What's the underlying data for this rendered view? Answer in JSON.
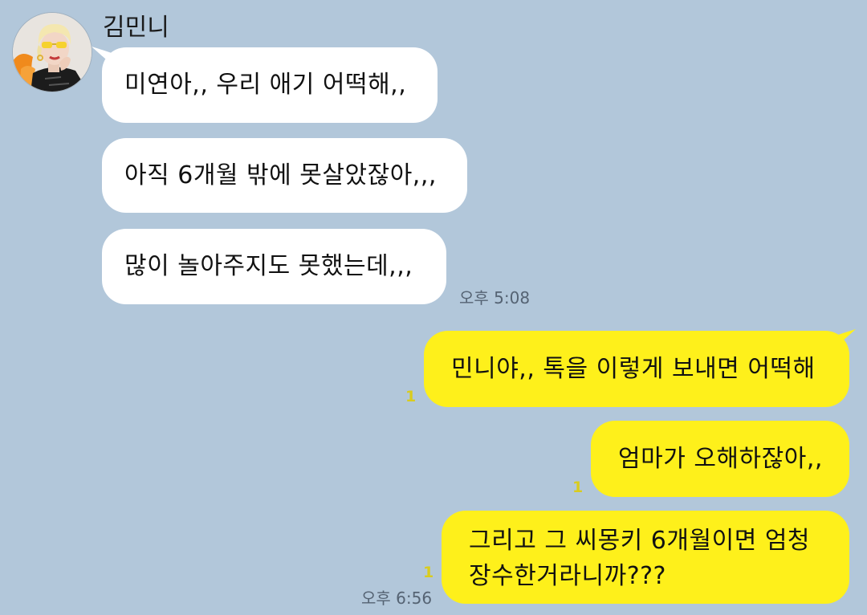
{
  "sender": {
    "name": "김민니",
    "avatar_icon": "profile-avatar"
  },
  "messages_in": [
    {
      "text": "미연아,, 우리 애기 어떡해,,"
    },
    {
      "text": "아직 6개월 밖에 못살았잖아,,,"
    },
    {
      "text": "많이 놀아주지도 못했는데,,,"
    }
  ],
  "time_in": "오후 5:08",
  "messages_out": [
    {
      "text": "민니야,, 톡을 이렇게 보내면 어떡해",
      "unread": "1"
    },
    {
      "text": "엄마가 오해하잖아,,",
      "unread": "1"
    },
    {
      "line1": "그리고 그 씨몽키 6개월이면 엄청",
      "line2": "장수한거라니까???",
      "unread": "1"
    }
  ],
  "time_out": "오후 6:56",
  "colors": {
    "background": "#b2c7da",
    "incoming_bubble": "#ffffff",
    "outgoing_bubble": "#fef01b",
    "unread_count": "#d9cc1e"
  }
}
